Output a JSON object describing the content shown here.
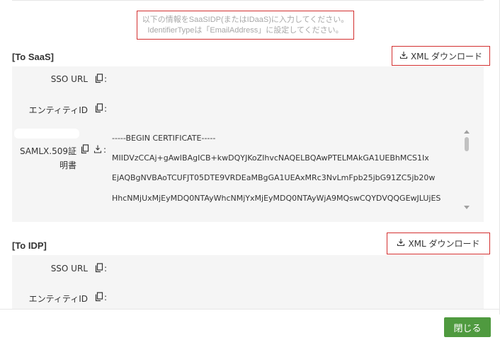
{
  "notice": {
    "line1": "以下の情報をSaaSIDP(またはIDaaS)に入力してください。",
    "line2": "IdentifierTypeは「EmailAddress」に設定してください。"
  },
  "to_saas": {
    "title": "[To SaaS]",
    "download_label": "XML ダウンロード",
    "sso_url_label": "SSO URL",
    "entity_id_label": "エンティティID",
    "cert_label_line1": "SAMLX.509証",
    "cert_label_line2": "明書",
    "cert_lines": [
      "-----BEGIN CERTIFICATE-----",
      "MIIDVzCCAj+gAwIBAgICB+kwDQYJKoZIhvcNAQELBQAwPTELMAkGA1UEBhMCS1Ix",
      "EjAQBgNVBAoTCUFJT05DTE9VRDEaMBgGA1UEAxMRc3NvLmFpb25jbG91ZC5jb20w",
      "HhcNMjUxMjEyMDQ0NTAyWhcNMjYxMjEyMDQ0NTAyWjA9MQswCQYDVQQGEwJLUjES"
    ]
  },
  "to_idp": {
    "title": "[To IDP]",
    "download_label": "XML ダウンロード",
    "sso_url_label": "SSO URL",
    "entity_id_label": "エンティティID"
  },
  "colon": ":",
  "footer": {
    "close_label": "閉じる"
  },
  "colors": {
    "accent_red": "#d32f2f",
    "close_green": "#4f9a3f",
    "panel_bg": "#f5f5f5"
  },
  "icons": {
    "copy": "copy-icon",
    "download": "download-icon",
    "tray_download": "tray-download-icon"
  }
}
